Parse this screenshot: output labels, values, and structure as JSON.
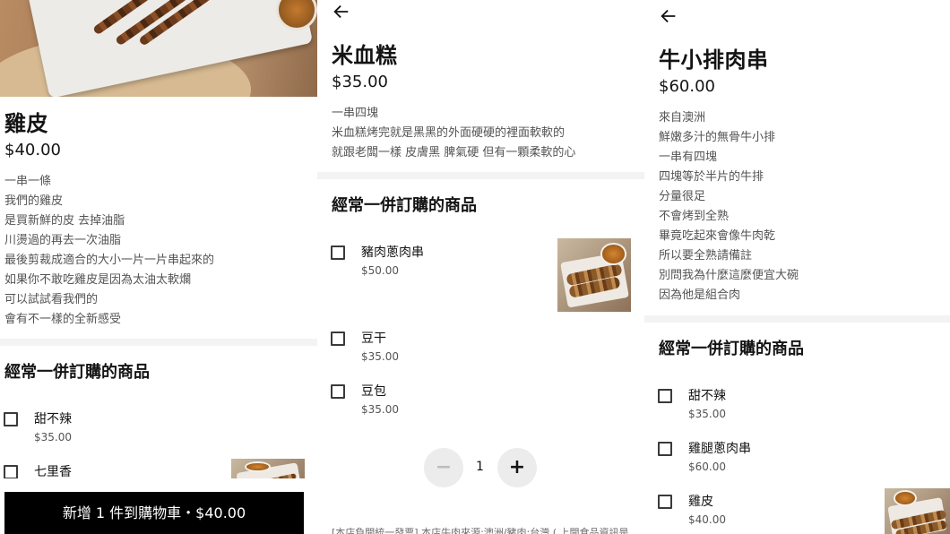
{
  "panel1": {
    "title": "雞皮",
    "price": "$40.00",
    "description": [
      "一串一條",
      "我們的雞皮",
      "是買新鮮的皮 去掉油脂",
      "川燙過的再去一次油脂",
      "最後剪裁成適合的大小一片一片串起來的",
      "如果你不敢吃雞皮是因為太油太軟爛",
      "可以試試看我們的",
      "會有不一樣的全新感受"
    ],
    "section_title": "經常一併訂購的商品",
    "options": [
      {
        "name": "甜不辣",
        "price": "$35.00"
      },
      {
        "name": "七里香",
        "price": ""
      }
    ],
    "add_button": "新增 1 件到購物車・$40.00"
  },
  "panel2": {
    "title": "米血糕",
    "price": "$35.00",
    "description": [
      "一串四塊",
      "米血糕烤完就是黑黑的外面硬硬的裡面軟軟的",
      "就跟老闆一樣 皮膚黑 脾氣硬 但有一顆柔軟的心"
    ],
    "section_title": "經常一併訂購的商品",
    "options": [
      {
        "name": "豬肉蔥肉串",
        "price": "$50.00"
      },
      {
        "name": "豆干",
        "price": "$35.00"
      },
      {
        "name": "豆包",
        "price": "$35.00"
      }
    ],
    "quantity": "1",
    "minus": "−",
    "plus": "+",
    "footer_note": "[本店負開統一發票] 本店牛肉來源:澳洲/豬肉:台灣 ( 上開食品資訊是"
  },
  "panel3": {
    "title": "牛小排肉串",
    "price": "$60.00",
    "description": [
      "來自澳洲",
      "鮮嫩多汁的無骨牛小排",
      "一串有四塊",
      "四塊等於半片的牛排",
      "分量很足",
      "不會烤到全熟",
      "畢竟吃起來會像牛肉乾",
      "所以要全熟請備註",
      "別問我為什麼這麼便宜大碗",
      "因為他是組合肉"
    ],
    "section_title": "經常一併訂購的商品",
    "options": [
      {
        "name": "甜不辣",
        "price": "$35.00"
      },
      {
        "name": "雞腿蔥肉串",
        "price": "$60.00"
      },
      {
        "name": "雞皮",
        "price": "$40.00"
      }
    ]
  }
}
